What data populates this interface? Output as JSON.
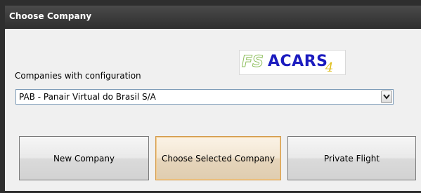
{
  "window": {
    "title": "Choose Company"
  },
  "logo": {
    "fs": "FS",
    "acars": "ACARS",
    "version": "4"
  },
  "companies": {
    "label": "Companies with configuration",
    "selected": "PAB - Panair Virtual do Brasil S/A"
  },
  "buttons": {
    "new_company": "New Company",
    "choose_selected": "Choose Selected Company",
    "private_flight": "Private Flight"
  },
  "colors": {
    "titlebar": "#2e2e2e",
    "title_text": "#ffffff",
    "logo_acars": "#1c1cbf",
    "logo_fs": "#8fbf5f",
    "logo_version": "#e0c020",
    "focused_button_border": "#d39a4a"
  }
}
